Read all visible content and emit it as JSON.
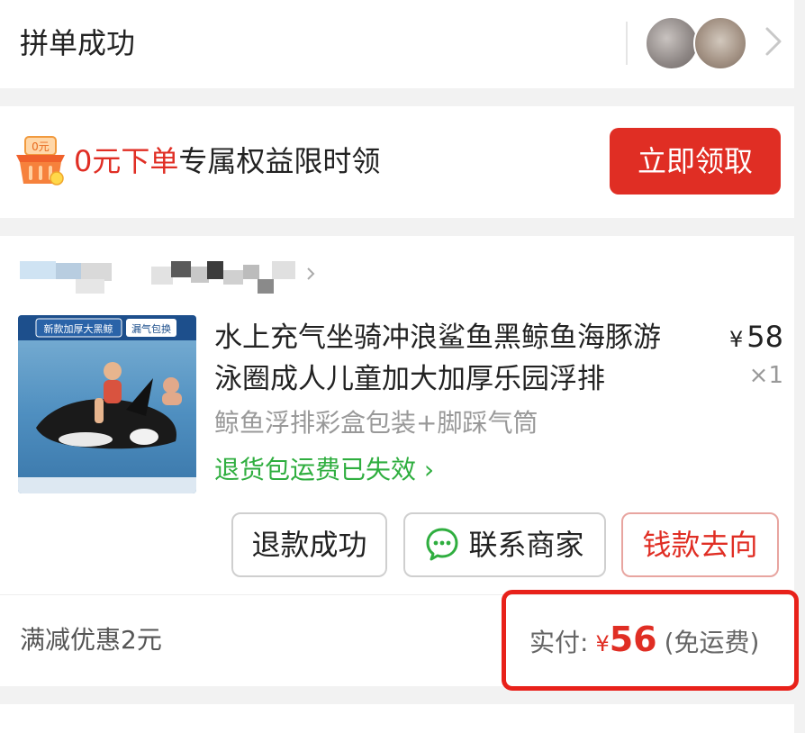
{
  "group_bar": {
    "title": "拼单成功"
  },
  "promo": {
    "basket_badge": "0元",
    "highlight": "0元下单",
    "text": "专属权益限时领",
    "claim_button": "立即领取"
  },
  "order": {
    "product": {
      "title": "水上充气坐骑冲浪鲨鱼黑鲸鱼海豚游泳圈成人儿童加大加厚乐园浮排",
      "spec": "鲸鱼浮排彩盒包装+脚踩气筒",
      "return_shipping": "退货包运费已失效",
      "currency": "¥",
      "unit_price": "58",
      "quantity": "×1",
      "image_tags": [
        "新款加厚大黑鲸",
        "漏气包换"
      ]
    },
    "buttons": {
      "refund": "退款成功",
      "contact": "联系商家",
      "money_flow": "钱款去向"
    },
    "discount": "满减优惠2元",
    "paid": {
      "label": "实付:",
      "currency": "¥",
      "amount": "56",
      "note": "(免运费)"
    }
  },
  "colors": {
    "accent": "#e02e24",
    "green": "#2fae3f",
    "highlight_box": "#e8211a"
  },
  "icons": [
    "chevron-right-icon",
    "basket-icon",
    "chat-bubble-icon"
  ]
}
